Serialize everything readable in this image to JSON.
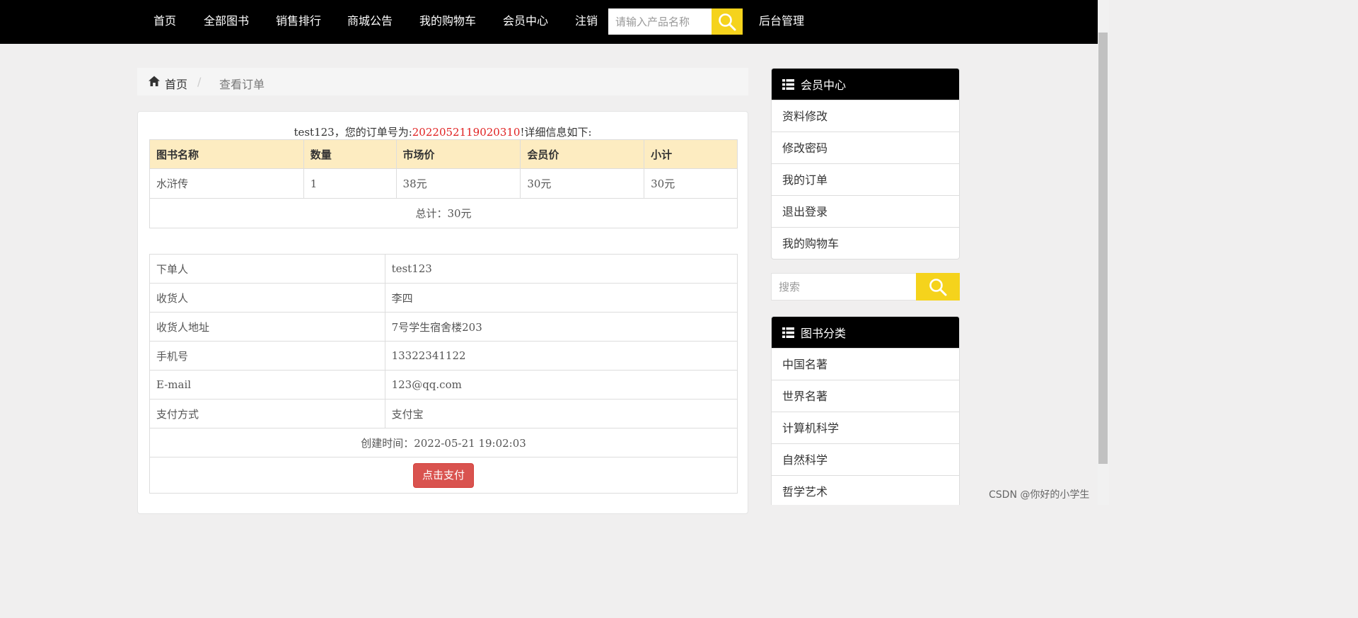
{
  "nav": {
    "items": [
      "首页",
      "全部图书",
      "销售排行",
      "商城公告",
      "我的购物车",
      "会员中心",
      "注销"
    ],
    "search_placeholder": "请输入产品名称",
    "admin_link": "后台管理"
  },
  "breadcrumb": {
    "home": "首页",
    "separator": "/",
    "current": "查看订单"
  },
  "order": {
    "user": "test123",
    "intro_before": "，您的订单号为:",
    "order_no": "2022052119020310",
    "intro_after": "!详细信息如下:",
    "columns": [
      "图书名称",
      "数量",
      "市场价",
      "会员价",
      "小计"
    ],
    "items": [
      {
        "name": "水浒传",
        "quantity": "1",
        "market_price": "38元",
        "member_price": "30元",
        "subtotal": "30元"
      }
    ],
    "total": "总计：30元"
  },
  "details": {
    "rows": [
      {
        "label": "下单人",
        "value": "test123"
      },
      {
        "label": "收货人",
        "value": "李四"
      },
      {
        "label": "收货人地址",
        "value": "7号学生宿舍楼203"
      },
      {
        "label": "手机号",
        "value": "13322341122"
      },
      {
        "label": "E-mail",
        "value": "123@qq.com"
      },
      {
        "label": "支付方式",
        "value": "支付宝"
      }
    ],
    "created": "创建时间：2022-05-21 19:02:03",
    "pay_button": "点击支付"
  },
  "member_center": {
    "title": "会员中心",
    "items": [
      "资料修改",
      "修改密码",
      "我的订单",
      "退出登录",
      "我的购物车"
    ]
  },
  "side_search": {
    "placeholder": "搜索"
  },
  "categories": {
    "title": "图书分类",
    "items": [
      "中国名著",
      "世界名著",
      "计算机科学",
      "自然科学",
      "哲学艺术"
    ]
  },
  "watermark": "CSDN @你好的小学生",
  "colors": {
    "navbar_bg": "#000000",
    "accent_yellow": "#f5d31c",
    "order_no_red": "#e02020",
    "table_header_bg": "#fdecc1",
    "pay_button_red": "#d9534f"
  }
}
